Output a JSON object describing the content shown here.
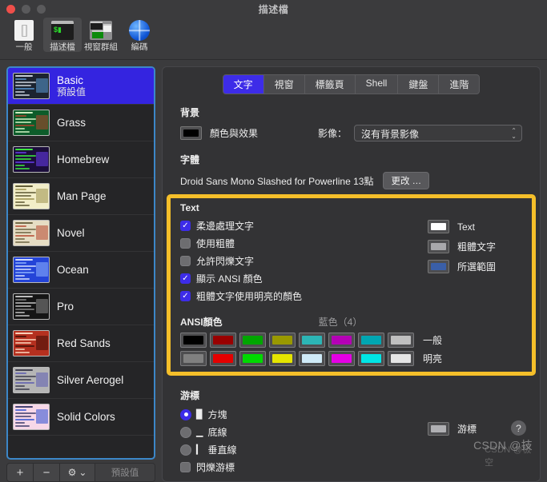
{
  "window": {
    "title": "描述檔",
    "traffic_lights": [
      "close",
      "minimize",
      "zoom"
    ]
  },
  "toolbar": {
    "items": [
      {
        "label": "一般",
        "icon": "general-icon",
        "active": false
      },
      {
        "label": "描述檔",
        "icon": "profile-icon",
        "active": true
      },
      {
        "label": "視窗群組",
        "icon": "window-groups-icon",
        "active": false
      },
      {
        "label": "編碼",
        "icon": "encoding-globe-icon",
        "active": false
      }
    ]
  },
  "sidebar": {
    "profiles": [
      {
        "name": "Basic",
        "subtitle": "預設值",
        "selected": true
      },
      {
        "name": "Grass",
        "subtitle": "",
        "selected": false
      },
      {
        "name": "Homebrew",
        "subtitle": "",
        "selected": false
      },
      {
        "name": "Man Page",
        "subtitle": "",
        "selected": false
      },
      {
        "name": "Novel",
        "subtitle": "",
        "selected": false
      },
      {
        "name": "Ocean",
        "subtitle": "",
        "selected": false
      },
      {
        "name": "Pro",
        "subtitle": "",
        "selected": false
      },
      {
        "name": "Red Sands",
        "subtitle": "",
        "selected": false
      },
      {
        "name": "Silver Aerogel",
        "subtitle": "",
        "selected": false
      },
      {
        "name": "Solid Colors",
        "subtitle": "",
        "selected": false
      }
    ],
    "thumbnail_colors": [
      {
        "bg": "#1c2430",
        "fg": "#cfd6e0",
        "accent": "#5b9bd5"
      },
      {
        "bg": "#0d5c2a",
        "fg": "#d6f5c8",
        "accent": "#b5432e"
      },
      {
        "bg": "#1b0d3a",
        "fg": "#3ef03e",
        "accent": "#6a3ef0"
      },
      {
        "bg": "#f2eec8",
        "fg": "#5b5530",
        "accent": "#9a8f4a"
      },
      {
        "bg": "#e6ddc4",
        "fg": "#6b6240",
        "accent": "#b4452e"
      },
      {
        "bg": "#2444d8",
        "fg": "#d8e2ff",
        "accent": "#8fb4ff"
      },
      {
        "bg": "#151515",
        "fg": "#c6c6c6",
        "accent": "#8a8a8a"
      },
      {
        "bg": "#b5301f",
        "fg": "#ffd8c0",
        "accent": "#3a0d06"
      },
      {
        "bg": "#b5b5b5",
        "fg": "#3a3a4a",
        "accent": "#5b5bb0"
      },
      {
        "bg": "#f7d8e8",
        "fg": "#3a3a6a",
        "accent": "#2b4fd0"
      }
    ],
    "bottom_bar": {
      "add_label": "+",
      "remove_label": "−",
      "gear_label": "⚙",
      "gear_chevron": "⌄",
      "default_label": "預設值"
    }
  },
  "main": {
    "tabs": [
      {
        "label": "文字",
        "active": true
      },
      {
        "label": "視窗",
        "active": false
      },
      {
        "label": "標籤頁",
        "active": false
      },
      {
        "label": "Shell",
        "active": false
      },
      {
        "label": "鍵盤",
        "active": false
      },
      {
        "label": "進階",
        "active": false
      }
    ],
    "background": {
      "heading": "背景",
      "color_effects_label": "顏色與效果",
      "swatch_color": "#000000",
      "image_label": "影像：",
      "image_value": "沒有背景影像"
    },
    "font": {
      "heading": "字體",
      "value": "Droid Sans Mono Slashed for Powerline 13點",
      "change_button": "更改 …"
    },
    "text": {
      "heading": "Text",
      "highlight_color": "#f5bf2a",
      "checkboxes": [
        {
          "label": "柔邊處理文字",
          "checked": true
        },
        {
          "label": "使用粗體",
          "checked": false
        },
        {
          "label": "允許閃爍文字",
          "checked": false
        },
        {
          "label": "顯示 ANSI 顏色",
          "checked": true
        },
        {
          "label": "粗體文字使用明亮的顏色",
          "checked": true
        }
      ],
      "color_wells": [
        {
          "label": "Text",
          "color": "#ffffff"
        },
        {
          "label": "粗體文字",
          "color": "#a8a8ab"
        },
        {
          "label": "所選範圍",
          "color": "#3a5fa8"
        }
      ],
      "ansi": {
        "heading": "ANSI顏色",
        "selected_info": "藍色（4）",
        "normal_label": "一般",
        "bright_label": "明亮",
        "normal": [
          "#000000",
          "#990000",
          "#00a600",
          "#999900",
          "#2cb5b5",
          "#b500b5",
          "#00a6b2",
          "#bfbfbf"
        ],
        "bright": [
          "#808080",
          "#e50000",
          "#00d900",
          "#e5e500",
          "#cfeaf7",
          "#e500e5",
          "#00e5e5",
          "#e5e5e5"
        ]
      }
    },
    "cursor": {
      "heading": "游標",
      "options": [
        {
          "label": "方塊",
          "glyph": "block",
          "selected": true
        },
        {
          "label": "底線",
          "glyph": "underline",
          "selected": false
        },
        {
          "label": "垂直線",
          "glyph": "vertical-bar",
          "selected": false
        }
      ],
      "blink": {
        "label": "閃爍游標",
        "checked": false
      },
      "well": {
        "label": "游標",
        "color": "#b0b0b3"
      }
    }
  },
  "overlay": {
    "watermark": "CSDN @技",
    "watermark_ghost": "CSDN @极空",
    "help_label": "?"
  }
}
